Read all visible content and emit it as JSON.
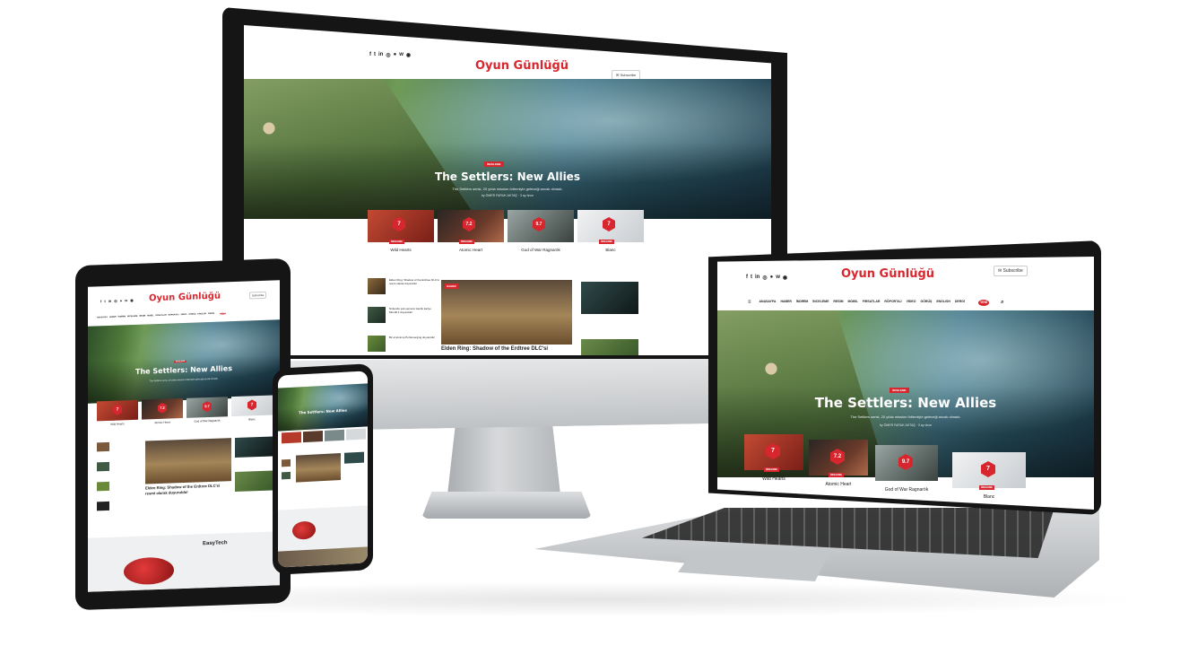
{
  "site": {
    "logo": "Oyun Günlüğü",
    "subscribe": "Subscribe",
    "social_icons": [
      "facebook-icon",
      "twitter-icon",
      "linkedin-icon",
      "instagram-icon",
      "reddit-icon",
      "vk-icon",
      "steam-icon"
    ],
    "nav": [
      "ANASAYFA",
      "HABER",
      "İNDİRİM",
      "İNCELEME",
      "RESİM",
      "MOBİL",
      "FIRSATLAR",
      "RÖPORTAJ",
      "VİDEO",
      "GÖRÜŞ",
      "ENGLISH",
      "DERGİ"
    ],
    "nav_badge": "YENİ"
  },
  "hero": {
    "tag": "İNCELEME",
    "title": "The Settlers: New Allies",
    "subtitle": "The Settlers serisi, 20 yılda mission örtlemiyle geleceği ancak olmadı.",
    "author": "ÖMER FARUK AKTAŞ",
    "time": "3 ay önce"
  },
  "cards": [
    {
      "name": "Wild Hearts",
      "score": "7",
      "tag": "İNCELEME",
      "color": "#b53a2a"
    },
    {
      "name": "Atomic Heart",
      "score": "7.2",
      "tag": "İNCELEME",
      "color": "#6a3a2a"
    },
    {
      "name": "God of War Ragnarök",
      "score": "9.7",
      "tag": "İNCELEME",
      "color": "#7a8a8a"
    },
    {
      "name": "Blanc",
      "score": "7",
      "tag": "İNCELEME",
      "color": "#d5d9dc"
    }
  ],
  "feature": {
    "title": "Elden Ring: Shadow of the Erdtree DLC'si",
    "tablet_title_1": "Elden Ring: Shadow of the Erdtree DLC'si",
    "tablet_title_2": "resmi olarak duyuruldu!",
    "tag": "HABER"
  },
  "side_list": [
    "Elden Ring: Shadow of the Erdtree DLC'si resmi olarak duyuruldu!",
    "Nintendo şok eşmerer kanlık kariye Mondil 2 duyuruldu!",
    "Bir el alınmış Pol Emerging duyuruldu!"
  ],
  "ad": {
    "brand": "EasyTech"
  },
  "colors": {
    "accent": "#d8262e",
    "bezel": "#151515",
    "stand": "#b9bcbf"
  }
}
